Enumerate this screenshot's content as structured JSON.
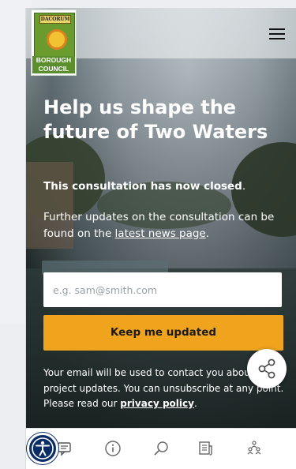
{
  "header": {
    "logo": {
      "banner_text": "DACORUM",
      "text_line1": "BOROUGH",
      "text_line2": "COUNCIL"
    },
    "menu_icon": "hamburger-menu-icon"
  },
  "hero": {
    "title": "Help us shape the future of Two Waters",
    "closed_text": "This consultation has now closed",
    "closed_period": ".",
    "updates_prefix": "Further updates on the consultation can be found on the ",
    "updates_link": "latest news page",
    "updates_suffix": "."
  },
  "form": {
    "email_placeholder": "e.g. sam@smith.com",
    "email_value": "",
    "submit_label": "Keep me updated",
    "disclaimer_text": "Your email will be used to contact you about project updates. You can unsubscribe at any point. Please read our ",
    "privacy_link": "privacy policy",
    "disclaimer_suffix": "."
  },
  "share_icon": "share-icon",
  "bottom_nav": {
    "items": [
      {
        "icon": "chat-icon"
      },
      {
        "icon": "info-icon"
      },
      {
        "icon": "search-icon"
      },
      {
        "icon": "news-icon"
      },
      {
        "icon": "people-icon"
      }
    ]
  },
  "accessibility_icon": "accessibility-icon",
  "colors": {
    "accent": "#f0a41e",
    "accessibility_button": "#0b2d66",
    "logo_green": "#5b8f2c"
  }
}
